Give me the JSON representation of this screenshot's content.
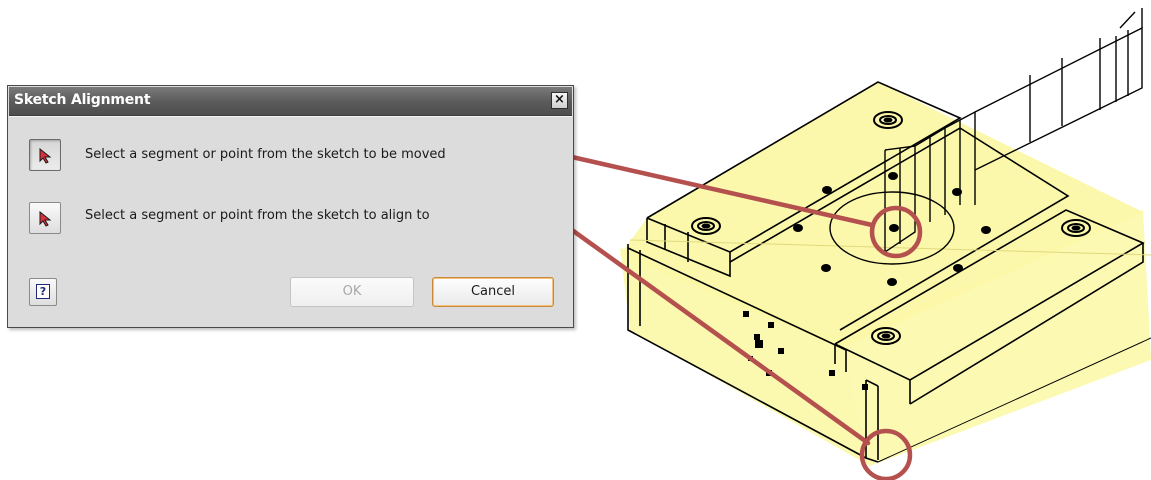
{
  "dialog": {
    "title": "Sketch Alignment",
    "close_label": "×",
    "rows": [
      {
        "icon": "pointer-select-icon",
        "label": "Select a segment or point from the sketch to be moved"
      },
      {
        "icon": "pointer-select-icon",
        "label": "Select a segment or point from the sketch to align to"
      }
    ],
    "help_label": "?",
    "ok_label": "OK",
    "cancel_label": "Cancel",
    "ok_enabled": false
  },
  "viewport": {
    "part_fill_color": "#fbf8a6",
    "callout_color": "#b4504e"
  }
}
